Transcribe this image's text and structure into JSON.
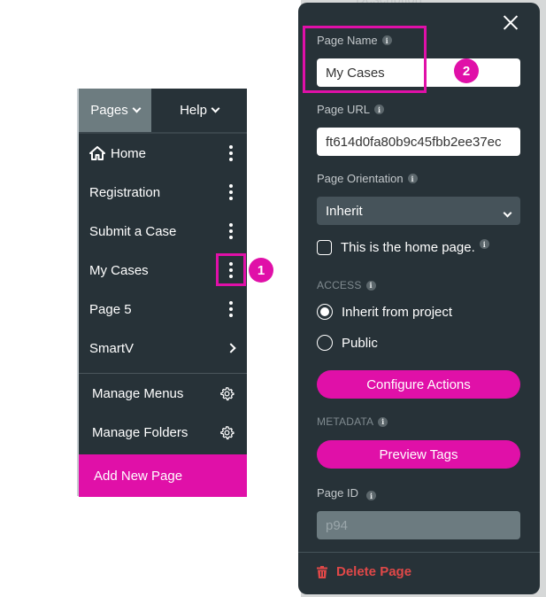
{
  "menu": {
    "tabs": [
      {
        "label": "Pages",
        "active": true
      },
      {
        "label": "Help",
        "active": false
      }
    ],
    "pages": [
      {
        "label": "Home",
        "icon": "home-icon",
        "action": "kebab"
      },
      {
        "label": "Registration",
        "action": "kebab"
      },
      {
        "label": "Submit a Case",
        "action": "kebab"
      },
      {
        "label": "My Cases",
        "action": "kebab"
      },
      {
        "label": "Page 5",
        "action": "kebab"
      },
      {
        "label": "SmartV",
        "action": "chevron-right"
      }
    ],
    "manage": [
      {
        "label": "Manage Menus",
        "icon": "gear-icon"
      },
      {
        "label": "Manage Folders",
        "icon": "gear-icon"
      }
    ],
    "add_page_label": "Add New Page"
  },
  "annotations": {
    "step1": "1",
    "step2": "2"
  },
  "panel": {
    "peek_label": "Description",
    "page_name": {
      "label": "Page Name",
      "value": "My Cases"
    },
    "page_url": {
      "label": "Page URL",
      "value": "ft614d0fa80b9c45fbb2ee37ec"
    },
    "page_orientation": {
      "label": "Page Orientation",
      "value": "Inherit"
    },
    "home_page_checkbox": {
      "label": "This is the home page.",
      "checked": false
    },
    "access": {
      "label": "ACCESS",
      "options": [
        {
          "label": "Inherit from project",
          "checked": true
        },
        {
          "label": "Public",
          "checked": false
        }
      ]
    },
    "configure_actions_label": "Configure Actions",
    "metadata": {
      "label": "METADATA",
      "preview_tags_label": "Preview Tags"
    },
    "page_id": {
      "label": "Page ID",
      "value": "p94"
    },
    "delete_label": "Delete Page"
  },
  "colors": {
    "accent": "#e010a8",
    "panel_bg": "#273238",
    "danger": "#e04848"
  }
}
